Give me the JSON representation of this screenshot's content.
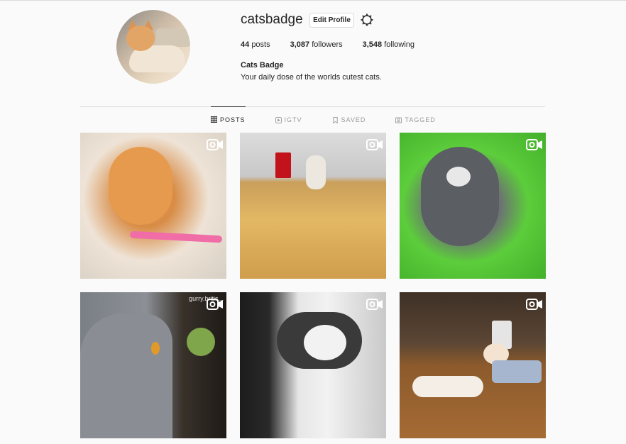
{
  "profile": {
    "username": "catsbadge",
    "edit_label": "Edit Profile",
    "stats": [
      {
        "count": "44",
        "label": "posts"
      },
      {
        "count": "3,087",
        "label": "followers"
      },
      {
        "count": "3,548",
        "label": "following"
      }
    ],
    "full_name": "Cats Badge",
    "bio": "Your daily dose of the worlds cutest cats."
  },
  "tabs": [
    {
      "label": "POSTS",
      "icon": "grid-icon",
      "active": true
    },
    {
      "label": "IGTV",
      "icon": "igtv-icon",
      "active": false
    },
    {
      "label": "SAVED",
      "icon": "bookmark-icon",
      "active": false
    },
    {
      "label": "TAGGED",
      "icon": "tag-icon",
      "active": false
    }
  ],
  "posts": [
    {
      "type": "video",
      "watermark": ""
    },
    {
      "type": "video",
      "watermark": ""
    },
    {
      "type": "video",
      "watermark": ""
    },
    {
      "type": "video",
      "watermark": "gurry.britis..."
    },
    {
      "type": "video",
      "watermark": ""
    },
    {
      "type": "video",
      "watermark": ""
    }
  ]
}
